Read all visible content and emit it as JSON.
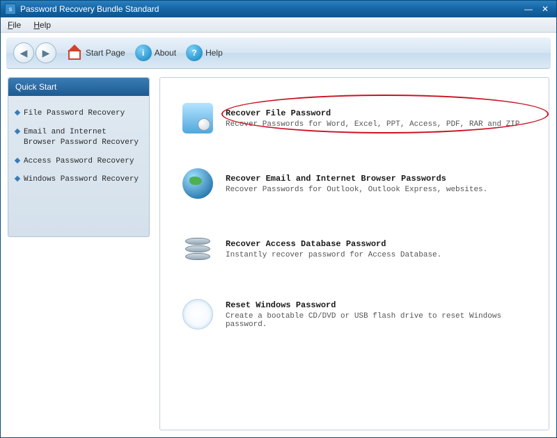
{
  "window": {
    "title": "Password Recovery Bundle Standard"
  },
  "menu": {
    "file": "File",
    "help": "Help"
  },
  "toolbar": {
    "start_page": "Start Page",
    "about": "About",
    "help": "Help"
  },
  "sidebar": {
    "header": "Quick Start",
    "items": [
      {
        "label": "File Password Recovery"
      },
      {
        "label": "Email and Internet Browser Password Recovery"
      },
      {
        "label": "Access Password Recovery"
      },
      {
        "label": "Windows Password Recovery"
      }
    ]
  },
  "options": [
    {
      "title": "Recover File Password",
      "desc": "Recover Passwords for Word, Excel, PPT, Access, PDF, RAR and ZIP",
      "highlighted": true
    },
    {
      "title": "Recover Email and Internet Browser Passwords",
      "desc": "Recover Passwords for Outlook, Outlook Express, websites."
    },
    {
      "title": "Recover Access Database Password",
      "desc": "Instantly recover password for Access Database."
    },
    {
      "title": "Reset Windows Password",
      "desc": "Create a bootable CD/DVD or USB flash drive to reset Windows password."
    }
  ]
}
